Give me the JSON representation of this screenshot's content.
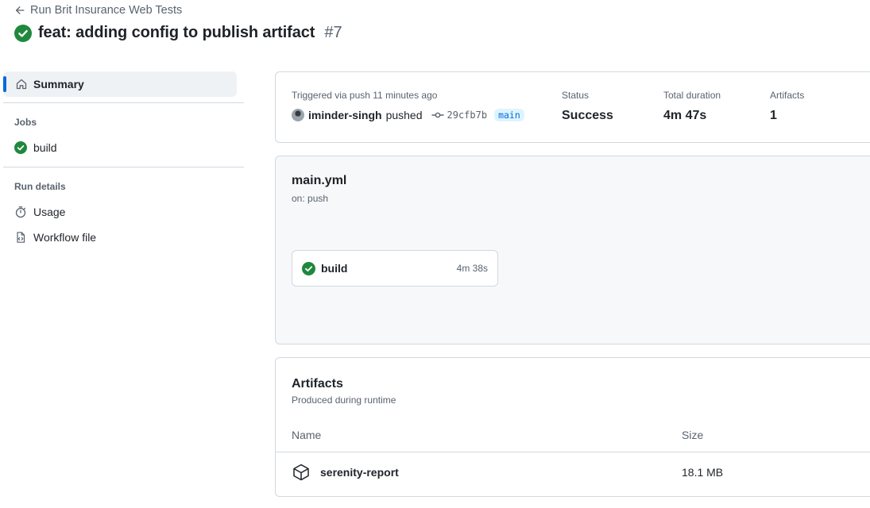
{
  "header": {
    "back_label": "Run Brit Insurance Web Tests",
    "title": "feat: adding config to publish artifact",
    "run_number": "#7"
  },
  "sidebar": {
    "summary_label": "Summary",
    "jobs_heading": "Jobs",
    "jobs": [
      {
        "label": "build",
        "status": "success"
      }
    ],
    "run_details_heading": "Run details",
    "details": [
      {
        "label": "Usage",
        "icon": "stopwatch-icon"
      },
      {
        "label": "Workflow file",
        "icon": "file-code-icon"
      }
    ]
  },
  "summary_card": {
    "trigger_text": "Triggered via push 11 minutes ago",
    "user": "iminder-singh",
    "action": "pushed",
    "commit": "29cfb7b",
    "branch": "main",
    "status_label": "Status",
    "status_value": "Success",
    "duration_label": "Total duration",
    "duration_value": "4m 47s",
    "artifacts_label": "Artifacts",
    "artifacts_value": "1"
  },
  "workflow": {
    "file": "main.yml",
    "trigger": "on: push",
    "job": {
      "name": "build",
      "duration": "4m 38s"
    }
  },
  "artifacts": {
    "title": "Artifacts",
    "subtitle": "Produced during runtime",
    "columns": {
      "name": "Name",
      "size": "Size"
    },
    "rows": [
      {
        "name": "serenity-report",
        "size": "18.1 MB"
      }
    ]
  },
  "colors": {
    "success": "#1f883d",
    "accent": "#0969da",
    "muted": "#59636e",
    "border": "#d1d9e0"
  }
}
